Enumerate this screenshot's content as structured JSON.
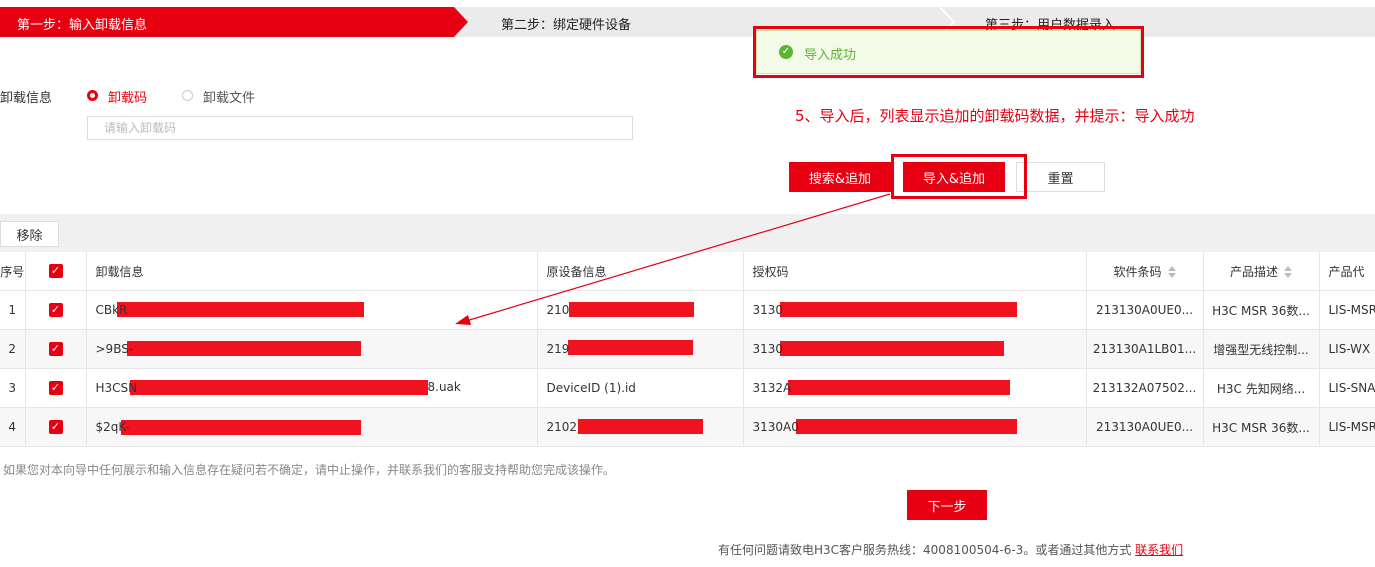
{
  "steps": {
    "step1": "第一步：输入卸载信息",
    "step2": "第二步：绑定硬件设备",
    "step3": "第三步：用户数据录入"
  },
  "toast": {
    "message": "导入成功",
    "icon": "check-circle-icon"
  },
  "annotation": "5、导入后，列表显示追加的卸载码数据，并提示：导入成功",
  "form": {
    "label": "卸载信息",
    "option_code": "卸载码",
    "option_file": "卸载文件",
    "selected": "卸载码",
    "input_placeholder": "请输入卸载码",
    "input_value": ""
  },
  "buttons": {
    "search_add": "搜索&追加",
    "import_add": "导入&追加",
    "reset": "重置",
    "remove": "移除",
    "next": "下一步"
  },
  "table": {
    "headers": [
      "序号",
      "",
      "卸载信息",
      "原设备信息",
      "授权码",
      "软件条码",
      "产品描述",
      "产品代"
    ],
    "rows": [
      {
        "index": "1",
        "checked": true,
        "uninstall": "CBkR",
        "device": "210",
        "auth": "3130",
        "barcode": "213130A0UE0...",
        "desc": "H3C MSR 36数...",
        "product": "LIS-MSR"
      },
      {
        "index": "2",
        "checked": true,
        "uninstall": ">9BS-",
        "device": "219",
        "auth": "3130",
        "barcode": "213130A1LB01...",
        "desc": "增强型无线控制...",
        "product": "LIS-WX"
      },
      {
        "index": "3",
        "checked": true,
        "uninstall": "H3CSN",
        "uninstall_suffix": "8.uak",
        "device": "DeviceID (1).id",
        "auth": "3132A",
        "barcode": "213132A07502...",
        "desc": "H3C 先知网络...",
        "product": "LIS-SNA"
      },
      {
        "index": "4",
        "checked": true,
        "uninstall": "$2qK-",
        "device": "2102",
        "auth": "3130A0",
        "barcode": "213130A0UE0...",
        "desc": "H3C MSR 36数...",
        "product": "LIS-MSR"
      }
    ]
  },
  "notice": "如果您对本向导中任何展示和输入信息存在疑问若不确定，请中止操作，并联系我们的客服支持帮助您完成该操作。",
  "footer": {
    "text": "有任何问题请致电H3C客户服务热线：4008100504-6-3。或者通过其他方式",
    "link": "联系我们"
  },
  "colors": {
    "brand": "#e60012",
    "success": "#5cb531"
  }
}
